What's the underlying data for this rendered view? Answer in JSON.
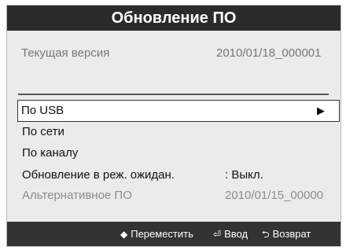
{
  "dialog": {
    "title": "Обновление ПО"
  },
  "current_version": {
    "label": "Текущая версия",
    "value": "2010/01/18_000001"
  },
  "menu": {
    "items": [
      {
        "label": "По USB",
        "value": "▶",
        "selected": true
      },
      {
        "label": "По сети"
      },
      {
        "label": "По каналу"
      },
      {
        "label": "Обновление в реж. ожидан.",
        "value": ": Выкл."
      },
      {
        "label": "Альтернативное ПО",
        "value": "2010/01/15_00000",
        "disabled": true
      }
    ]
  },
  "footer": {
    "move_icon": "up-down-arrows-icon",
    "move_glyph": "◆",
    "move_label": "Переместить",
    "enter_icon": "enter-icon",
    "enter_glyph": "⏎",
    "enter_label": "Ввод",
    "return_icon": "return-icon",
    "return_glyph": "⮌",
    "return_label": "Возврат"
  },
  "colors": {
    "title_bar": "#2b2b2b",
    "background": "#ebebeb",
    "footer": "#333333",
    "disabled_text": "#8c8c8c"
  }
}
